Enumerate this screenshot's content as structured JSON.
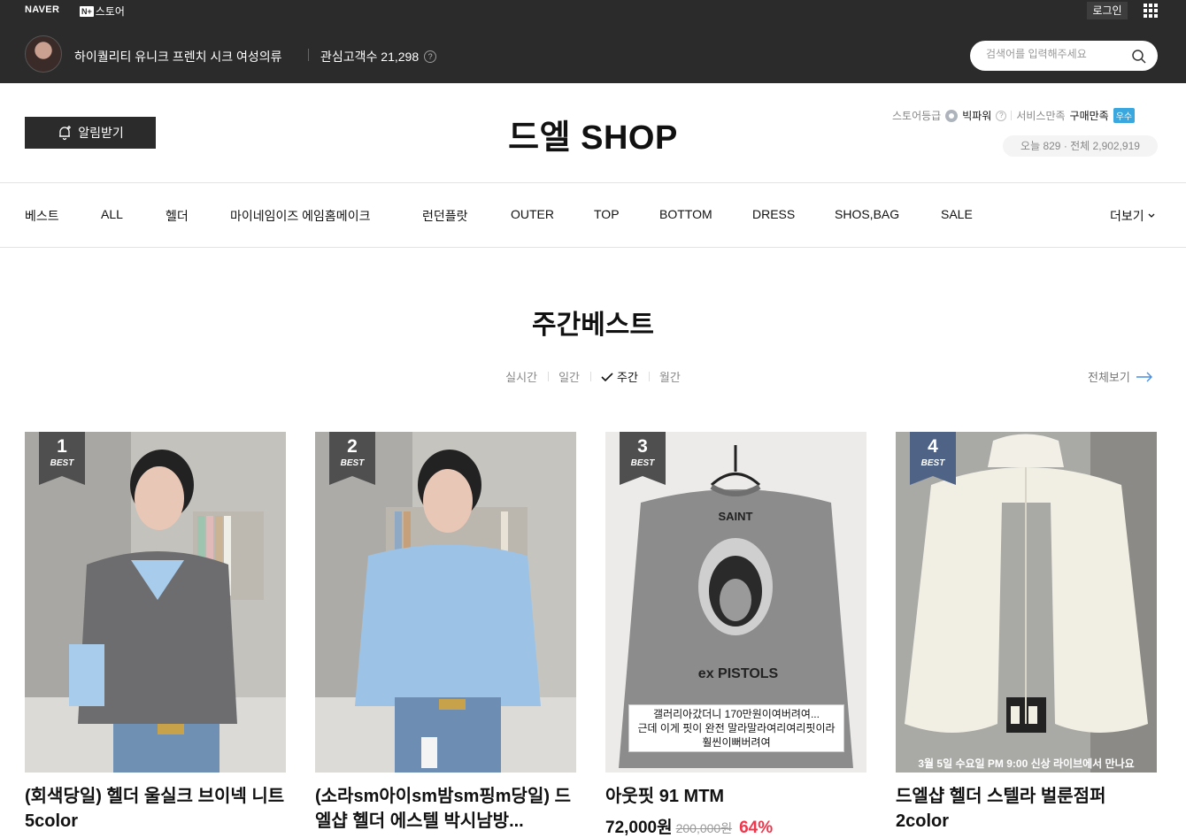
{
  "global": {
    "naver_logo": "NAVER",
    "store_badge": "N+",
    "store_label": "스토어",
    "login": "로그인"
  },
  "store": {
    "description": "하이퀄리티 유니크 프렌치 시크 여성의류",
    "fans_label": "관심고객수 21,298",
    "search_placeholder": "검색어를 입력해주세요",
    "name": "드엘 SHOP",
    "alarm_button": "알림받기",
    "grade_label": "스토어등급",
    "grade_value": "빅파워",
    "service_label": "서비스만족",
    "purchase_label": "구매만족",
    "purchase_badge": "우수",
    "visits": "오늘 829 · 전체 2,902,919"
  },
  "nav": {
    "items": [
      "베스트",
      "ALL",
      "헬더",
      "마이네임이즈 에임홈메이크",
      "런던플랏",
      "OUTER",
      "TOP",
      "BOTTOM",
      "DRESS",
      "SHOS,BAG",
      "SALE"
    ],
    "more": "더보기"
  },
  "section": {
    "title": "주간베스트",
    "periods": [
      "실시간",
      "일간",
      "주간",
      "월간"
    ],
    "active_period": "주간",
    "view_all": "전체보기"
  },
  "products": [
    {
      "rank": "1",
      "badge": "BEST",
      "name": "(회색당일) 헬더 울실크 브이넥 니트 5color"
    },
    {
      "rank": "2",
      "badge": "BEST",
      "name": "(소라sm아이sm밤sm핑m당일) 드엘샵 헬더 에스텔 박시남방..."
    },
    {
      "rank": "3",
      "badge": "BEST",
      "name": "아웃핏 91 MTM",
      "price": "72,000원",
      "original_price": "200,000원",
      "discount": "64%",
      "image_caption": [
        "갤러리아갔더니 170만원이여버려여...",
        "근데 이게 핏이 완전 말라말라여리여리핏이라",
        "훨씬이뻐버려여"
      ],
      "shirt_text": [
        "SAINT",
        "ex PISTOLS"
      ]
    },
    {
      "rank": "4",
      "badge": "BEST",
      "name": "드엘샵 헬더 스텔라 벌룬점퍼 2color",
      "image_caption": "3월 5일 수요일 PM 9:00 신상 라이브에서 만나요"
    }
  ],
  "colors": {
    "dark_bar": "#2b2b2b",
    "discount": "#f0364b",
    "badge_blue": "#3aa7df"
  }
}
